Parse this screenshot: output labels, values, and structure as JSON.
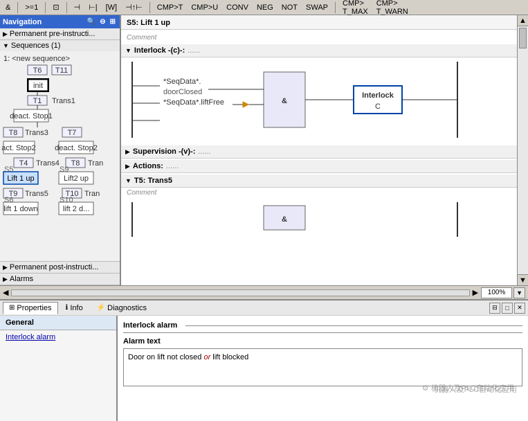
{
  "nav": {
    "title": "Navigation",
    "sections": [
      {
        "label": "Permanent pre-instructi...",
        "expanded": false
      },
      {
        "label": "Sequences (1)",
        "expanded": true
      },
      {
        "label": "Permanent post-instructi...",
        "expanded": false
      },
      {
        "label": "Alarms",
        "expanded": false
      }
    ],
    "tree_sequence": "1: <new sequence>"
  },
  "toolbar": {
    "items": [
      "&",
      ">=1",
      "⊡",
      "⊣",
      "⊣|",
      "[W]",
      "⊣↑⊢",
      "CMP>T",
      "CMP>U",
      "CONV",
      "NEG",
      "NOT",
      "SWAP",
      "CMP>T_MAX",
      "CMP>T_WARN"
    ]
  },
  "diagram": {
    "step_label": "S5: Lift 1 up",
    "comment": "Comment",
    "sections": [
      {
        "label": "Interlock -(c)-:",
        "dots": "......",
        "expanded": true,
        "comment": "",
        "logic": {
          "inputs": [
            "*SeqData*.doorClosed",
            "*SeqData*.liftFree"
          ],
          "gate": "&",
          "output": "Interlock",
          "output_type": "C"
        }
      },
      {
        "label": "Supervision -(v)-:",
        "dots": "......",
        "expanded": false
      },
      {
        "label": "Actions:",
        "dots": "......",
        "expanded": false
      },
      {
        "label": "T5: Trans5",
        "dots": "",
        "expanded": true,
        "comment": "Comment",
        "logic": {
          "gate": "&"
        }
      }
    ]
  },
  "status": {
    "zoom": "100%",
    "scroll_label": "|||"
  },
  "properties_bar": {
    "tabs": [
      {
        "label": "Properties",
        "icon": "⊞",
        "active": true
      },
      {
        "label": "Info",
        "icon": "ℹ",
        "active": false
      },
      {
        "label": "Diagnostics",
        "icon": "⚡",
        "active": false
      }
    ],
    "buttons": [
      "⊟",
      "□",
      "✕"
    ]
  },
  "bottom_panel": {
    "left_tab": "General",
    "left_items": [
      "Interlock alarm"
    ],
    "right": {
      "title": "Interlock alarm",
      "alarm_text_label": "Alarm text",
      "alarm_text": "Door on lift not closed or lift blocked"
    }
  },
  "watermark": "机器人及PLC自动化应用"
}
